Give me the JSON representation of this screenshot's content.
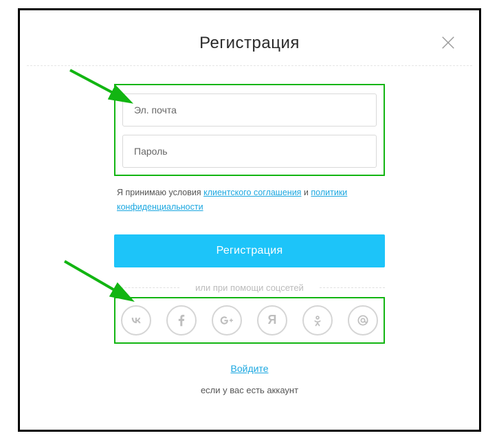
{
  "header": {
    "title": "Регистрация"
  },
  "form": {
    "email_placeholder": "Эл. почта",
    "password_placeholder": "Пароль"
  },
  "terms": {
    "prefix": "Я принимаю условия ",
    "link1": "клиентского соглашения",
    "mid": " и ",
    "link2": "политики конфиденциальности"
  },
  "primary_button": "Регистрация",
  "social_label": "или при помощи соцсетей",
  "login": {
    "link": "Войдите",
    "hint": "если у вас есть аккаунт"
  },
  "social": {
    "yandex_letter": "Я"
  }
}
